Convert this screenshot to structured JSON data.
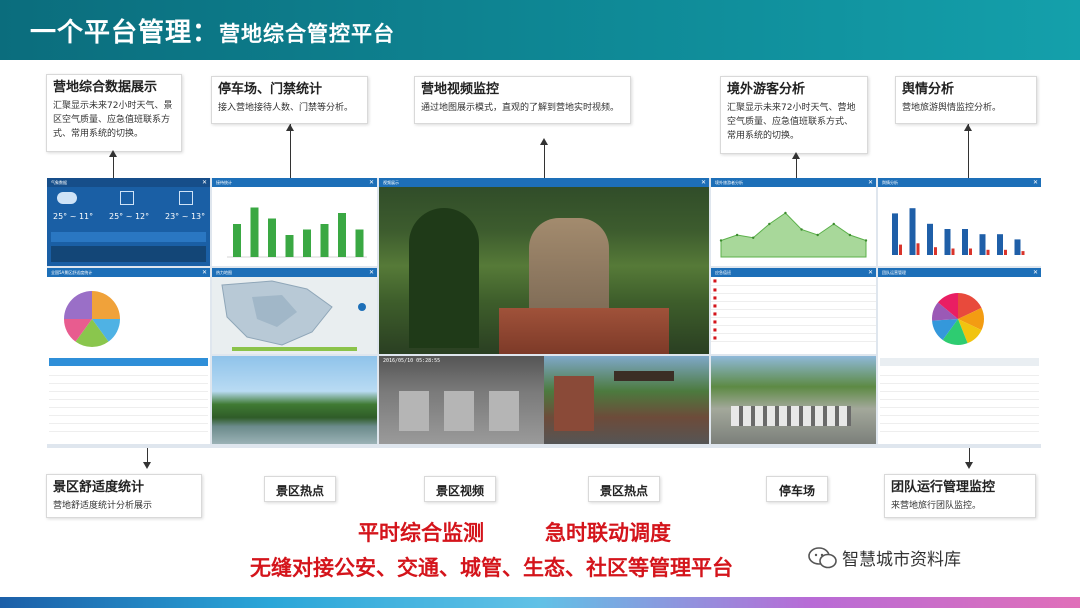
{
  "header": {
    "title_main": "一个平台管理：",
    "title_sub": "营地综合管控平台"
  },
  "callouts": {
    "data_display": {
      "title": "营地综合数据展示",
      "desc": "汇聚显示未来72小时天气、景区空气质量、应急值班联系方式、常用系统的切换。"
    },
    "parking_gate": {
      "title": "停车场、门禁统计",
      "desc": "接入营地接待人数、门禁等分析。"
    },
    "video": {
      "title": "营地视频监控",
      "desc": "通过地图展示模式，直观的了解到营地实时视频。"
    },
    "overseas": {
      "title": "境外游客分析",
      "desc": "汇聚显示未来72小时天气、营地空气质量、应急值班联系方式、常用系统的切换。"
    },
    "opinion": {
      "title": "舆情分析",
      "desc": "营地旅游舆情监控分析。"
    },
    "comfort": {
      "title": "景区舒适度统计",
      "desc": "营地舒适度统计分析展示"
    },
    "team": {
      "title": "团队运行管理监控",
      "desc": "来营地旅行团队监控。"
    }
  },
  "labels": {
    "hotspot1": "景区热点",
    "video": "景区视频",
    "hotspot2": "景区热点",
    "parking": "停车场"
  },
  "slogans": {
    "line1a": "平时综合监测",
    "line1b": "急时联动调度",
    "line2": "无缝对接公安、交通、城管、生态、社区等管理平台"
  },
  "watermark": "智慧城市资料库",
  "dashboard": {
    "weather_panel": "气象数据",
    "weather": [
      {
        "temp": "25° ~ 11°"
      },
      {
        "temp": "25° ~ 12°"
      },
      {
        "temp": "23° ~ 13°"
      }
    ],
    "visitor_panel": "接待统计",
    "comfort_panel": "全国5A景区舒适度统计",
    "map_panel": "热力地图",
    "video_panel": "视频展示",
    "video_timestamp": "2016/05/10 05:28:55",
    "overseas_panel": "境外旅游者分析",
    "opinion_panel": "舆情分析",
    "event_panel": "应急值班",
    "team_panel": "团队运营管理",
    "gate_timestamp": "2016/05/10 05:28:55"
  },
  "chart_data": [
    {
      "type": "bar",
      "name": "visitor",
      "values": [
        6,
        9,
        7,
        4,
        5,
        6,
        8,
        5
      ]
    },
    {
      "type": "area",
      "name": "overseas",
      "values": [
        3,
        4,
        3.5,
        6,
        8,
        5,
        4,
        6,
        4,
        3
      ]
    },
    {
      "type": "bar",
      "name": "opinion",
      "values": [
        8,
        9,
        6,
        5,
        5,
        4,
        4,
        3
      ]
    },
    {
      "type": "pie",
      "name": "comfort",
      "values": [
        25,
        15,
        20,
        15,
        25
      ],
      "colors": [
        "#f0a23a",
        "#4fb2e4",
        "#8ac64d",
        "#e85c8f",
        "#9a6fc7"
      ]
    },
    {
      "type": "pie",
      "name": "team",
      "values": [
        18,
        14,
        12,
        16,
        14,
        12,
        14
      ],
      "colors": [
        "#e84a3c",
        "#f39c12",
        "#f1c40f",
        "#2ecc71",
        "#3498db",
        "#9b59b6",
        "#e91e63"
      ]
    }
  ]
}
